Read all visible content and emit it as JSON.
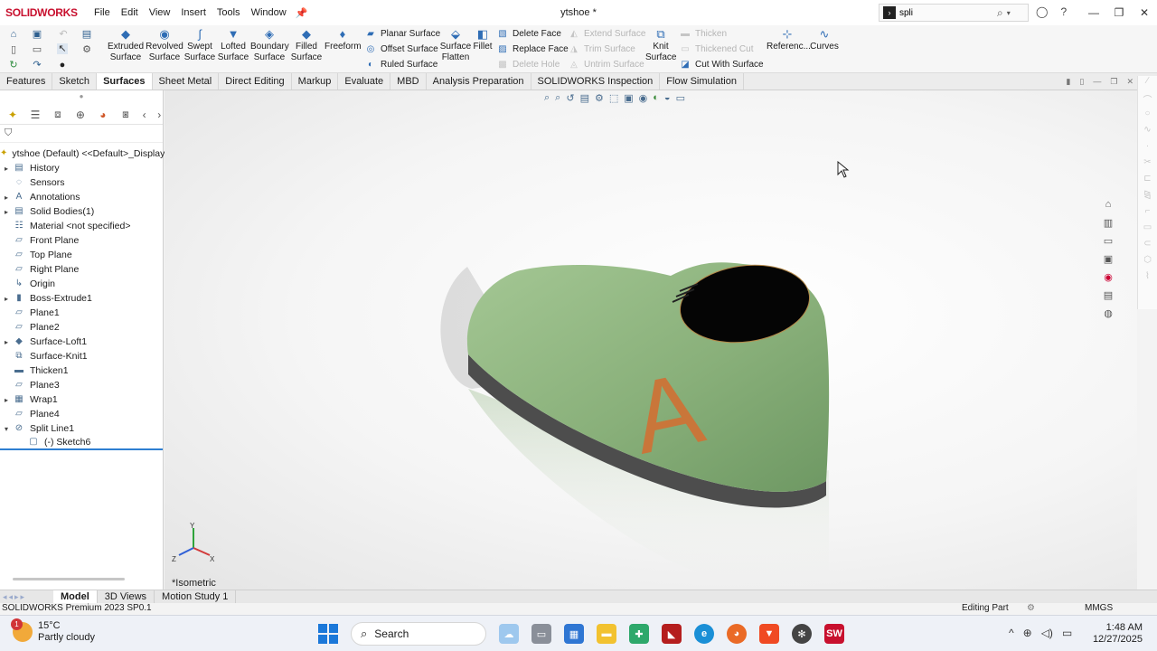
{
  "app": {
    "logo_brand": "SOLIDWORKS",
    "doc_title": "ytshoe *",
    "menus": [
      "File",
      "Edit",
      "View",
      "Insert",
      "Tools",
      "Window"
    ],
    "search_value": "spli"
  },
  "commands": {
    "extruded": "Extruded Surface",
    "revolved": "Revolved Surface",
    "swept": "Swept Surface",
    "lofted": "Lofted Surface",
    "boundary": "Boundary Surface",
    "filled": "Filled Surface",
    "freeform": "Freeform",
    "planar": "Planar Surface",
    "offset": "Offset Surface",
    "ruled": "Ruled Surface",
    "flatten": "Surface Flatten",
    "fillet": "Fillet",
    "delete_face": "Delete Face",
    "replace_face": "Replace Face",
    "delete_hole": "Delete Hole",
    "extend": "Extend Surface",
    "trim": "Trim Surface",
    "untrim": "Untrim Surface",
    "knit": "Knit Surface",
    "thicken": "Thicken",
    "thickened_cut": "Thickened Cut",
    "cut_with": "Cut With Surface",
    "reference": "Referenc...",
    "curves": "Curves"
  },
  "tabs": [
    "Features",
    "Sketch",
    "Surfaces",
    "Sheet Metal",
    "Direct Editing",
    "Markup",
    "Evaluate",
    "MBD",
    "Analysis Preparation",
    "SOLIDWORKS Inspection",
    "Flow Simulation"
  ],
  "active_tab": "Surfaces",
  "tree": {
    "root": "ytshoe (Default) <<Default>_Display",
    "items": [
      {
        "label": "History",
        "expandable": true,
        "icon": "folder-icon"
      },
      {
        "label": "Sensors",
        "expandable": false,
        "icon": "sensor-icon"
      },
      {
        "label": "Annotations",
        "expandable": true,
        "icon": "annotation-icon"
      },
      {
        "label": "Solid Bodies(1)",
        "expandable": true,
        "icon": "folder-icon"
      },
      {
        "label": "Material <not specified>",
        "expandable": false,
        "icon": "material-icon"
      },
      {
        "label": "Front Plane",
        "expandable": false,
        "icon": "plane-icon"
      },
      {
        "label": "Top Plane",
        "expandable": false,
        "icon": "plane-icon"
      },
      {
        "label": "Right Plane",
        "expandable": false,
        "icon": "plane-icon"
      },
      {
        "label": "Origin",
        "expandable": false,
        "icon": "origin-icon"
      },
      {
        "label": "Boss-Extrude1",
        "expandable": true,
        "icon": "extrude-icon"
      },
      {
        "label": "Plane1",
        "expandable": false,
        "icon": "plane-icon"
      },
      {
        "label": "Plane2",
        "expandable": false,
        "icon": "plane-icon"
      },
      {
        "label": "Surface-Loft1",
        "expandable": true,
        "icon": "loft-icon"
      },
      {
        "label": "Surface-Knit1",
        "expandable": false,
        "icon": "knit-icon"
      },
      {
        "label": "Thicken1",
        "expandable": false,
        "icon": "thicken-icon"
      },
      {
        "label": "Plane3",
        "expandable": false,
        "icon": "plane-icon"
      },
      {
        "label": "Wrap1",
        "expandable": true,
        "icon": "wrap-icon"
      },
      {
        "label": "Plane4",
        "expandable": false,
        "icon": "plane-icon"
      },
      {
        "label": "Split Line1",
        "expandable": true,
        "expanded": true,
        "icon": "split-line-icon"
      },
      {
        "label": "(-) Sketch6",
        "expandable": false,
        "child": true,
        "icon": "sketch-icon"
      }
    ]
  },
  "viewport": {
    "view_name": "*Isometric",
    "model_color": "#8db57e",
    "logo_letter": "A",
    "triad_labels": [
      "X",
      "Y",
      "Z"
    ]
  },
  "bottom_tabs": [
    "Model",
    "3D Views",
    "Motion Study 1"
  ],
  "status": {
    "left": "SOLIDWORKS Premium 2023 SP0.1",
    "mode": "Editing Part",
    "units": "MMGS"
  },
  "taskbar": {
    "temperature": "15°C",
    "condition": "Partly cloudy",
    "badge": "1",
    "search_label": "Search",
    "time": "1:48 AM",
    "date": "12/27/2025",
    "sw_label": "SW"
  }
}
